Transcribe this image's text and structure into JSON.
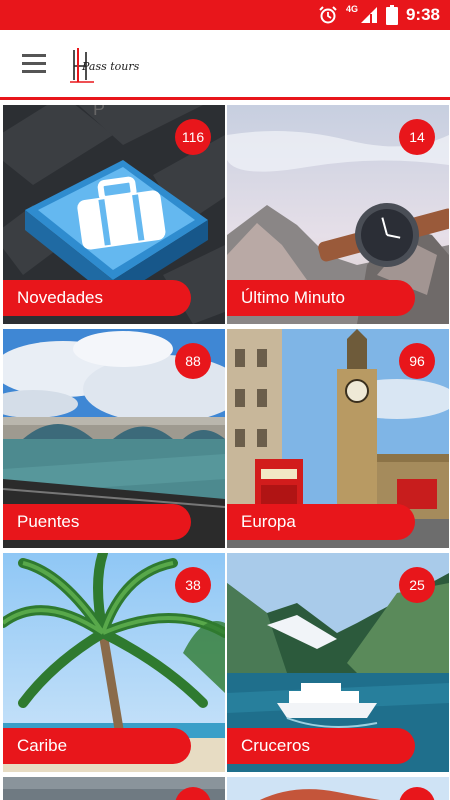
{
  "status_bar": {
    "time": "9:38",
    "network": "4G",
    "icons": [
      "alarm-icon",
      "signal-icon",
      "battery-icon"
    ],
    "color": "#e8161b"
  },
  "app_bar": {
    "menu_icon": "hamburger-menu-icon",
    "logo_text": "Pass tours",
    "accent": "#e8161b"
  },
  "tiles": [
    {
      "label": "Novedades",
      "count": "116"
    },
    {
      "label": "Último Minuto",
      "count": "14"
    },
    {
      "label": "Puentes",
      "count": "88"
    },
    {
      "label": "Europa",
      "count": "96"
    },
    {
      "label": "Caribe",
      "count": "38"
    },
    {
      "label": "Cruceros",
      "count": "25"
    }
  ]
}
